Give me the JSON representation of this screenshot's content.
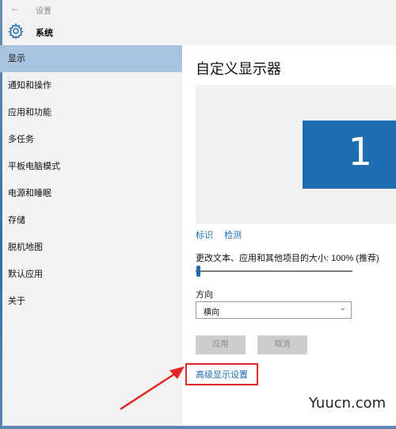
{
  "window": {
    "title": "设置",
    "back_icon": "back-arrow-icon"
  },
  "sidebar": {
    "section_title": "系统",
    "section_icon": "gear-icon",
    "items": [
      {
        "label": "显示",
        "active": true
      },
      {
        "label": "通知和操作"
      },
      {
        "label": "应用和功能"
      },
      {
        "label": "多任务"
      },
      {
        "label": "平板电脑模式"
      },
      {
        "label": "电源和睡眠"
      },
      {
        "label": "存储"
      },
      {
        "label": "脱机地图"
      },
      {
        "label": "默认应用"
      },
      {
        "label": "关于"
      }
    ]
  },
  "main": {
    "title": "自定义显示器",
    "monitor_number": "1",
    "identify_link": "标识",
    "detect_link": "检测",
    "scale_label": "更改文本、应用和其他项目的大小: 100% (推荐)",
    "scale_value_percent": 100,
    "orientation_label": "方向",
    "orientation_value": "横向",
    "apply_button": "应用",
    "cancel_button": "取消",
    "advanced_link": "高级显示设置"
  },
  "watermark": "Yuucn.com",
  "colors": {
    "accent": "#1f6cb1",
    "active_nav": "#a8c3dd",
    "link": "#1a6bb5",
    "highlight_box": "#e22626"
  }
}
